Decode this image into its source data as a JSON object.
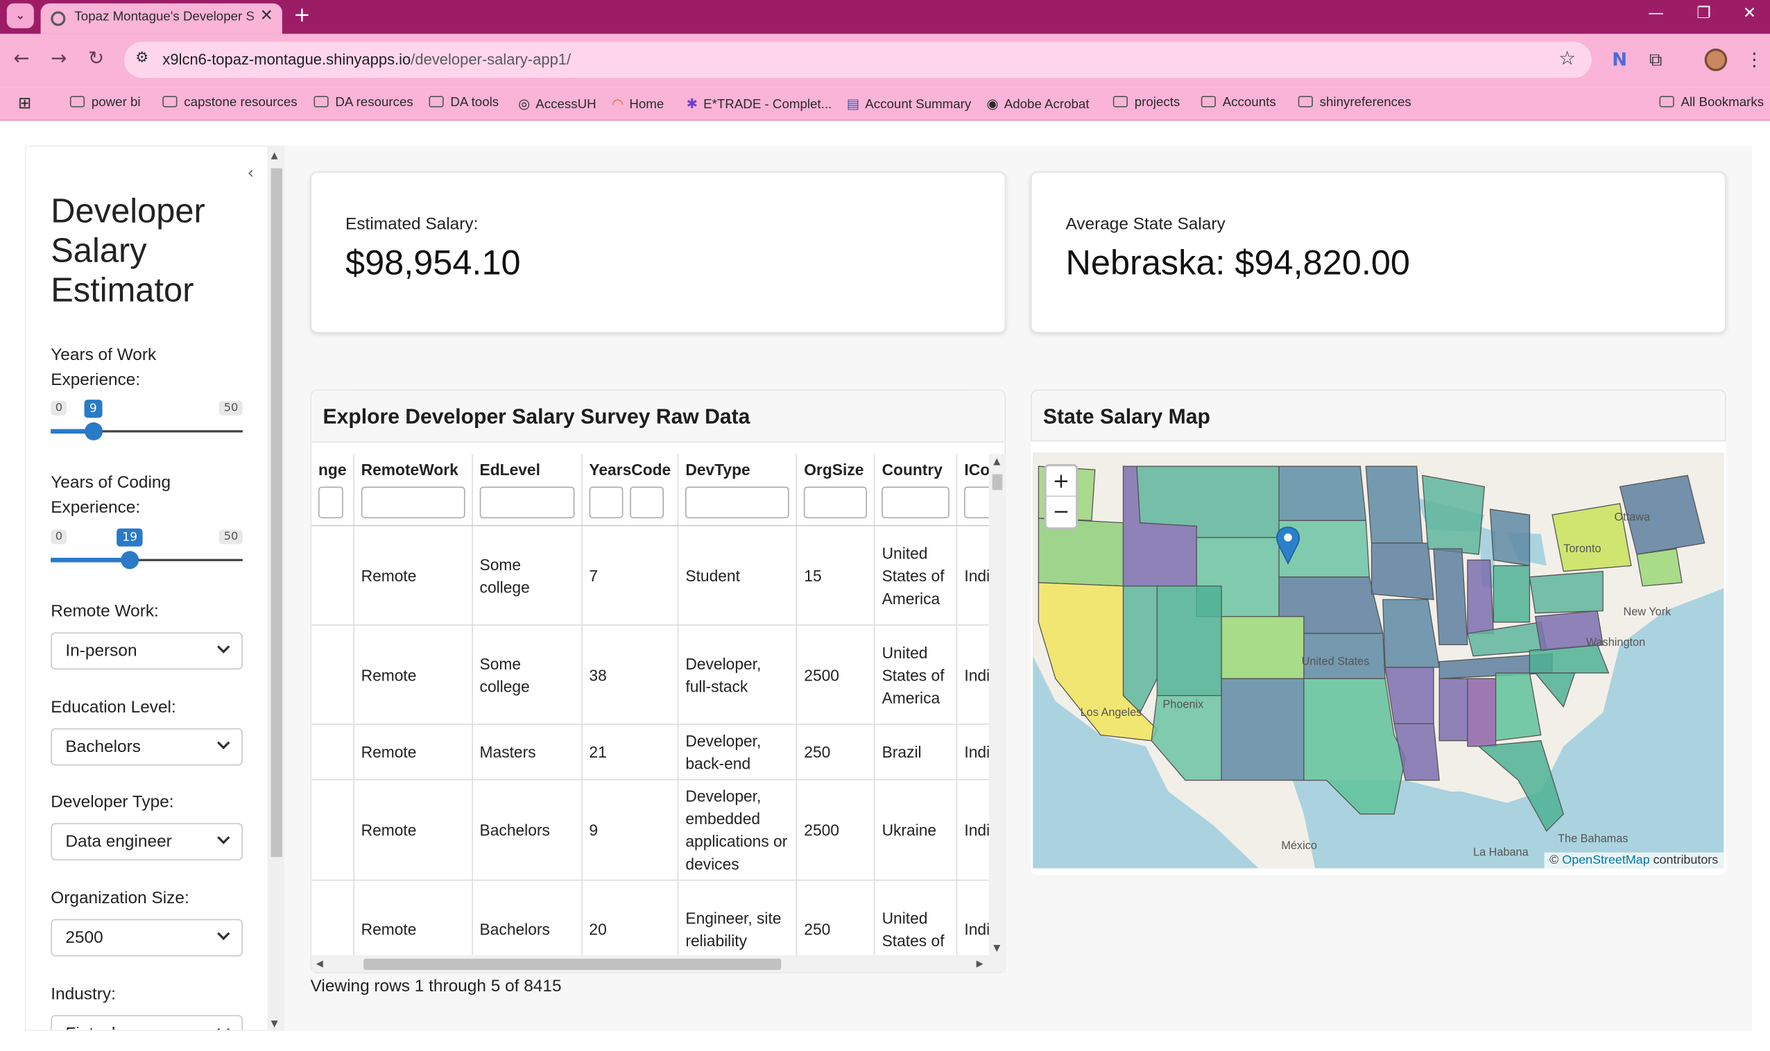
{
  "browser": {
    "tab_title": "Topaz Montague's Developer S",
    "url_host": "x9lcn6-topaz-montague.shinyapps.io",
    "url_path": "/developer-salary-app1/",
    "bookmarks": [
      "power bi",
      "capstone resources",
      "DA resources",
      "DA tools",
      "AccessUH",
      "Home",
      "E*TRADE - Complet...",
      "Account Summary",
      "Adobe Acrobat",
      "projects",
      "Accounts",
      "shinyreferences"
    ],
    "all_bookmarks": "All Bookmarks"
  },
  "sidebar": {
    "title": "Developer Salary Estimator",
    "work_exp": {
      "label": "Years of Work Experience:",
      "min": "0",
      "max": "50",
      "value": "9",
      "fraction": 0.18
    },
    "code_exp": {
      "label": "Years of Coding Experience:",
      "min": "0",
      "max": "50",
      "value": "19",
      "fraction": 0.38
    },
    "remote": {
      "label": "Remote Work:",
      "value": "In-person"
    },
    "education": {
      "label": "Education Level:",
      "value": "Bachelors"
    },
    "devtype": {
      "label": "Developer Type:",
      "value": "Data engineer"
    },
    "orgsize": {
      "label": "Organization Size:",
      "value": "2500"
    },
    "industry": {
      "label": "Industry:",
      "value": "Fintech"
    }
  },
  "estimated": {
    "label": "Estimated Salary:",
    "value": "$98,954.10"
  },
  "state_avg": {
    "label": "Average State Salary",
    "value": "Nebraska: $94,820.00"
  },
  "table_card": {
    "title": "Explore Developer Salary Survey Raw Data",
    "columns": [
      "nge",
      "RemoteWork",
      "EdLevel",
      "YearsCode",
      "DevType",
      "OrgSize",
      "Country",
      "ICorPM"
    ],
    "rows": [
      [
        "",
        "Remote",
        "Some college",
        "7",
        "Student",
        "15",
        "United States of America",
        "Individual contributor"
      ],
      [
        "",
        "Remote",
        "Some college",
        "38",
        "Developer, full-stack",
        "2500",
        "United States of America",
        "Individual contributor"
      ],
      [
        "",
        "Remote",
        "Masters",
        "21",
        "Developer, back-end",
        "250",
        "Brazil",
        "Individual contributor"
      ],
      [
        "",
        "Remote",
        "Bachelors",
        "9",
        "Developer, embedded applications or devices",
        "2500",
        "Ukraine",
        "Individual contributor"
      ],
      [
        "",
        "Remote",
        "Bachelors",
        "20",
        "Engineer, site reliability",
        "250",
        "United States of",
        "Individual contributor"
      ]
    ],
    "info": "Viewing rows 1 through 5 of 8415"
  },
  "map_card": {
    "title": "State Salary Map",
    "zoom_in": "+",
    "zoom_out": "−",
    "attribution_prefix": "©",
    "attribution_link": "OpenStreetMap",
    "attribution_suffix": "contributors",
    "cities": [
      "Ottawa",
      "Toronto",
      "New York",
      "Washington",
      "United States",
      "Los Angeles",
      "Phoenix",
      "México",
      "La Habana",
      "The Bahamas"
    ]
  }
}
